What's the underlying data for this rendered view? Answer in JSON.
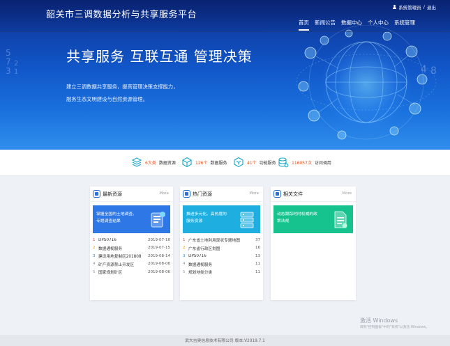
{
  "header": {
    "title": "韶关市三调数据分析与共享服务平台",
    "user": "系统管理员",
    "separator": "/",
    "logout": "退出",
    "nav": [
      "首页",
      "新闻公告",
      "数据中心",
      "个人中心",
      "系统管理"
    ],
    "active_nav": "首页"
  },
  "hero": {
    "headline": "共享服务  互联互通  管理决策",
    "subline_1": "建立三调数据共享服务，提高管理决策支撑能力，",
    "subline_2": "服务生态文明建设与自然资源管理。"
  },
  "stats": [
    {
      "icon": "layers-icon",
      "value": "6大类",
      "label": "数据资源"
    },
    {
      "icon": "cube-network-icon",
      "value": "126个",
      "label": "数据服务"
    },
    {
      "icon": "hexagon-icon",
      "value": "41个",
      "label": "功能服务"
    },
    {
      "icon": "database-icon",
      "value": "116057次",
      "label": "访问调用"
    }
  ],
  "cards": {
    "latest": {
      "title": "最新资源",
      "more": "More",
      "banner_line_1": "掌握全国的土地调查、",
      "banner_line_2": "专题调查结果",
      "banner_color": "#2d78e6",
      "items": [
        {
          "index": "1",
          "name": "DPS0716",
          "date": "2019-07-16"
        },
        {
          "index": "2",
          "name": "数据通视服务",
          "date": "2019-07-15"
        },
        {
          "index": "3",
          "name": "建设用地复制区201808",
          "date": "2019-08-14"
        },
        {
          "index": "4",
          "name": "矿产资源禁止开发区",
          "date": "2019-08-06"
        },
        {
          "index": "5",
          "name": "国家规划矿区",
          "date": "2019-08-06"
        }
      ]
    },
    "hot": {
      "title": "热门资源",
      "more": "More",
      "banner_line_1": "推进多元化、高热度的",
      "banner_line_2": "服务资源",
      "banner_color": "#1eaee0",
      "items": [
        {
          "index": "1",
          "name": "广东省土地利用现状专题地图",
          "count": "37"
        },
        {
          "index": "2",
          "name": "广东省行政区划图",
          "count": "16"
        },
        {
          "index": "3",
          "name": "DPS0716",
          "count": "13"
        },
        {
          "index": "4",
          "name": "数据通视服务",
          "count": "11"
        },
        {
          "index": "5",
          "name": "规划地类分类",
          "count": "11"
        }
      ]
    },
    "files": {
      "title": "相关文件",
      "more": "More",
      "banner_line_1": "动态跟踪时时权威的政",
      "banner_line_2": "策法规",
      "banner_color": "#16c38f"
    }
  },
  "watermark": {
    "title": "激活 Windows",
    "subtitle": "转到\"控制面板\"中的\"系统\"以激活 Windows。"
  },
  "footer": {
    "text": "武大吉奥信息技术有限公司   版本:V2019.7.1"
  }
}
